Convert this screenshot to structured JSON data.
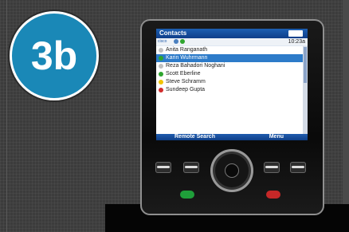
{
  "badge": {
    "label": "3b",
    "color": "#1a88b7"
  },
  "phone": {
    "app_title": "Contacts",
    "brand_label": "cisco",
    "time": "10:23a",
    "contacts": [
      {
        "name": "Anita Ranganath",
        "status_icon": "offline-icon",
        "status_color": "#c0c0c0",
        "selected": false
      },
      {
        "name": "Karin Wuhrmann",
        "status_icon": "available-icon",
        "status_color": "#2fa52f",
        "selected": true
      },
      {
        "name": "Reza Bahadori Noghani",
        "status_icon": "offline-icon",
        "status_color": "#c0c0c0",
        "selected": false
      },
      {
        "name": "Scott Eberline",
        "status_icon": "available-icon",
        "status_color": "#2fa52f",
        "selected": false
      },
      {
        "name": "Steve Schramm",
        "status_icon": "away-icon",
        "status_color": "#f2c400",
        "selected": false
      },
      {
        "name": "Sundeep Gupta",
        "status_icon": "busy-icon",
        "status_color": "#d22d2d",
        "selected": false
      }
    ],
    "softkeys": {
      "left": "Remote Search",
      "right": "Menu"
    }
  }
}
